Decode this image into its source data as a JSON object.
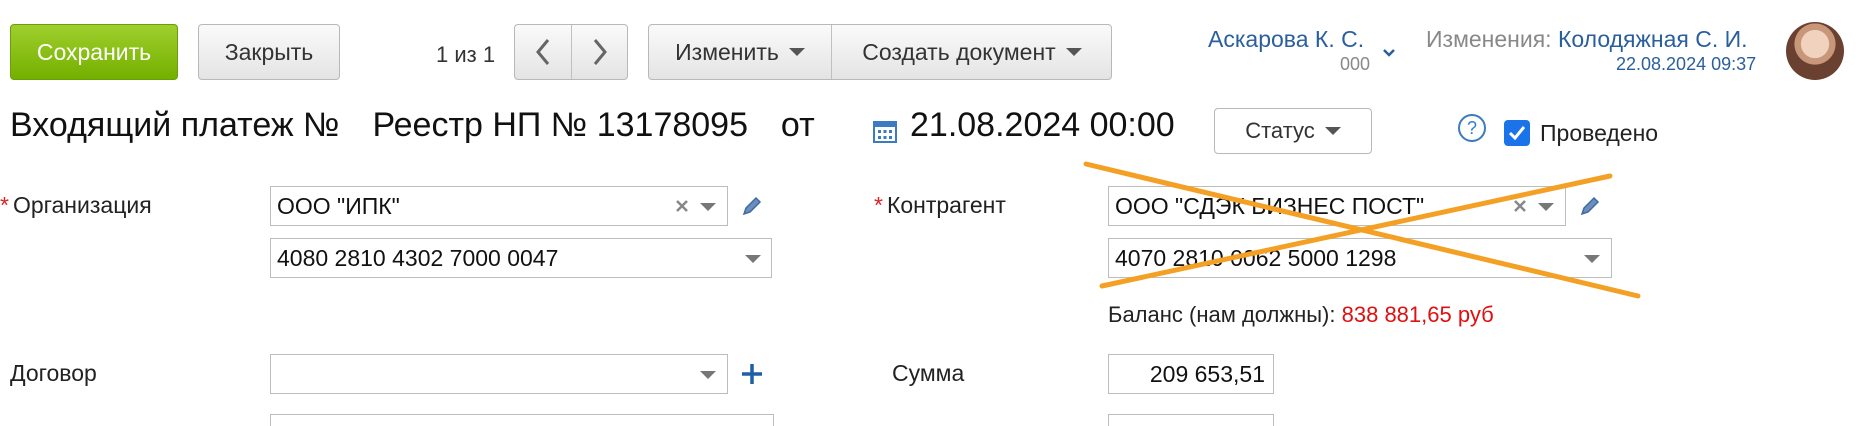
{
  "toolbar": {
    "save_label": "Сохранить",
    "close_label": "Закрыть",
    "counter": "1 из 1",
    "change_label": "Изменить",
    "create_doc_label": "Создать документ"
  },
  "user": {
    "name": "Аскарова К. С.",
    "code": "000"
  },
  "changes": {
    "label": "Изменения:",
    "author": "Колодяжная С. И.",
    "datetime": "22.08.2024 09:37"
  },
  "header": {
    "title": "Входящий платеж №",
    "number": "Реестр НП № 13178095",
    "from_label": "от",
    "date": "21.08.2024 00:00",
    "status_label": "Статус",
    "help_glyph": "?",
    "posted_label": "Проведено"
  },
  "form": {
    "org_label": "Организация",
    "org_value": "ООО \"ИПК\"",
    "org_account": "4080 2810 4302 7000 0047",
    "contractor_label": "Контрагент",
    "contractor_value": "ООО \"СДЭК БИЗНЕС ПОСТ\"",
    "contractor_account": "4070 2810 0062 5000 1298",
    "balance_label": "Баланс (нам должны):",
    "balance_value": "838 881,65 руб",
    "contract_label": "Договор",
    "contract_value": "",
    "sum_label": "Сумма",
    "sum_value": "209 653,51",
    "required_mark": "*"
  },
  "colors": {
    "accent_green": "#7ab800",
    "link_blue": "#2a5f9e",
    "balance_red": "#e01010",
    "cross_orange": "#f4a024"
  },
  "icons": {
    "prev": "chevron-left-icon",
    "next": "chevron-right-icon",
    "calendar": "calendar-icon",
    "clear": "clear-x-icon",
    "edit": "pencil-icon",
    "add": "plus-icon",
    "help": "help-icon",
    "checkbox": "checkbox-checked-icon"
  }
}
